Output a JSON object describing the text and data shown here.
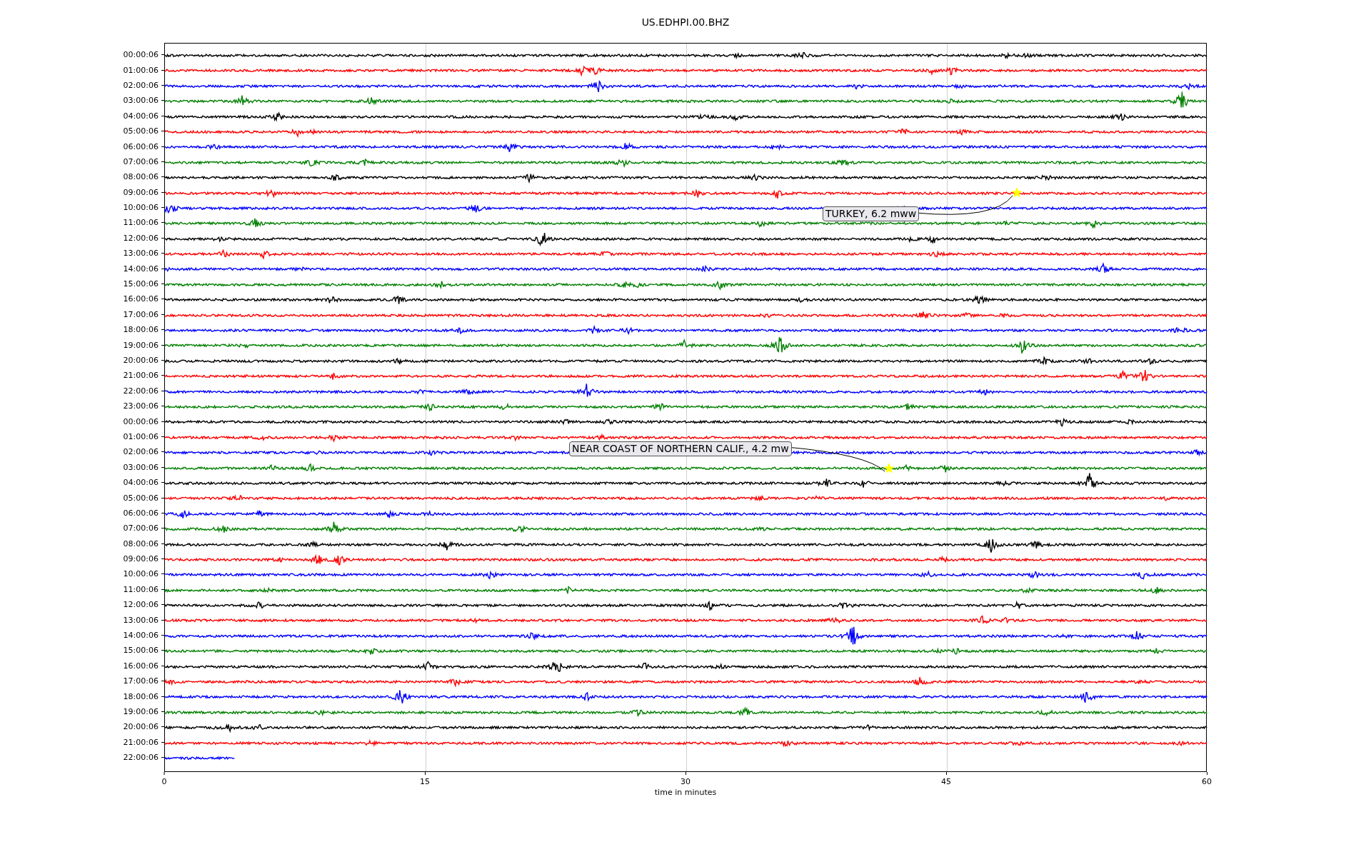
{
  "title": "US.EDHPI.00.BHZ",
  "rows": [
    {
      "label": "00:00:06",
      "color": "#000000",
      "level": 1
    },
    {
      "label": "01:00:06",
      "color": "#ff0000",
      "level": 1
    },
    {
      "label": "02:00:06",
      "color": "#0000ff",
      "level": 1
    },
    {
      "label": "03:00:06",
      "color": "#008000",
      "level": 1
    },
    {
      "label": "04:00:06",
      "color": "#000000",
      "level": 1
    },
    {
      "label": "05:00:06",
      "color": "#ff0000",
      "level": 1
    },
    {
      "label": "06:00:06",
      "color": "#0000ff",
      "level": 1
    },
    {
      "label": "07:00:06",
      "color": "#008000",
      "level": 1
    },
    {
      "label": "08:00:06",
      "color": "#000000",
      "level": 1
    },
    {
      "label": "09:00:06",
      "color": "#ff0000",
      "level": 1
    },
    {
      "label": "10:00:06",
      "color": "#0000ff",
      "level": 1
    },
    {
      "label": "11:00:06",
      "color": "#008000",
      "level": 1
    },
    {
      "label": "12:00:06",
      "color": "#000000",
      "level": 1
    },
    {
      "label": "13:00:06",
      "color": "#ff0000",
      "level": 1
    },
    {
      "label": "14:00:06",
      "color": "#0000ff",
      "level": 1
    },
    {
      "label": "15:00:06",
      "color": "#008000",
      "level": 1
    },
    {
      "label": "16:00:06",
      "color": "#000000",
      "level": 1
    },
    {
      "label": "17:00:06",
      "color": "#ff0000",
      "level": 1
    },
    {
      "label": "18:00:06",
      "color": "#0000ff",
      "level": 1
    },
    {
      "label": "19:00:06",
      "color": "#008000",
      "level": 1
    },
    {
      "label": "20:00:06",
      "color": "#000000",
      "level": 1
    },
    {
      "label": "21:00:06",
      "color": "#ff0000",
      "level": 1
    },
    {
      "label": "22:00:06",
      "color": "#0000ff",
      "level": 1
    },
    {
      "label": "23:00:06",
      "color": "#008000",
      "level": 1
    },
    {
      "label": "00:00:06",
      "color": "#000000",
      "level": 1
    },
    {
      "label": "01:00:06",
      "color": "#ff0000",
      "level": 1
    },
    {
      "label": "02:00:06",
      "color": "#0000ff",
      "level": 1
    },
    {
      "label": "03:00:06",
      "color": "#008000",
      "level": 1
    },
    {
      "label": "04:00:06",
      "color": "#000000",
      "level": 1
    },
    {
      "label": "05:00:06",
      "color": "#ff0000",
      "level": 1
    },
    {
      "label": "06:00:06",
      "color": "#0000ff",
      "level": 1
    },
    {
      "label": "07:00:06",
      "color": "#008000",
      "level": 1
    },
    {
      "label": "08:00:06",
      "color": "#000000",
      "level": 1
    },
    {
      "label": "09:00:06",
      "color": "#ff0000",
      "level": 1
    },
    {
      "label": "10:00:06",
      "color": "#0000ff",
      "level": 1
    },
    {
      "label": "11:00:06",
      "color": "#008000",
      "level": 1
    },
    {
      "label": "12:00:06",
      "color": "#000000",
      "level": 1
    },
    {
      "label": "13:00:06",
      "color": "#ff0000",
      "level": 1
    },
    {
      "label": "14:00:06",
      "color": "#0000ff",
      "level": 1
    },
    {
      "label": "15:00:06",
      "color": "#008000",
      "level": 1
    },
    {
      "label": "16:00:06",
      "color": "#000000",
      "level": 1
    },
    {
      "label": "17:00:06",
      "color": "#ff0000",
      "level": 1
    },
    {
      "label": "18:00:06",
      "color": "#0000ff",
      "level": 1
    },
    {
      "label": "19:00:06",
      "color": "#008000",
      "level": 1
    },
    {
      "label": "20:00:06",
      "color": "#000000",
      "level": 1
    },
    {
      "label": "21:00:06",
      "color": "#ff0000",
      "level": 1
    },
    {
      "label": "22:00:06",
      "color": "#0000ff",
      "level": 0.067
    }
  ],
  "x_ticks": [
    "0",
    "15",
    "30",
    "45",
    "60"
  ],
  "xlabel": "time in minutes",
  "annotations": [
    {
      "text": "TURKEY, 6.2 mww"
    },
    {
      "text": "NEAR COAST OF NORTHERN CALIF., 4.2 mw"
    }
  ]
}
